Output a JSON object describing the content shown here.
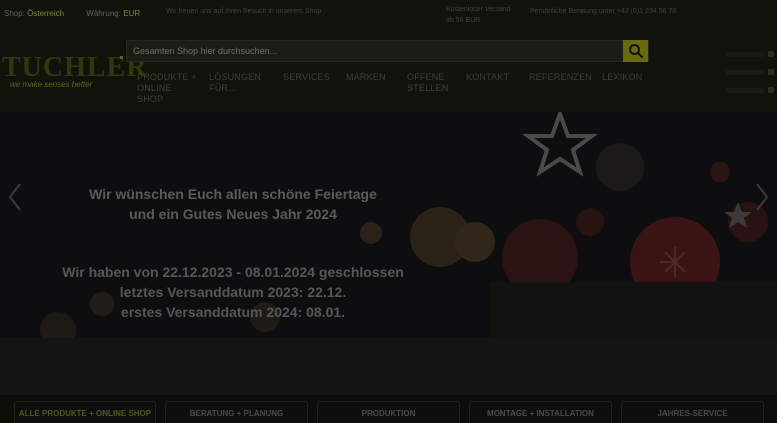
{
  "topbar": {
    "shop_label": "Shop",
    "shop_value": "Österreich",
    "currency_label": "Währung",
    "currency_value": "EUR",
    "msg_left": "Wir freuen uns auf Ihren Besuch in unserem Shop",
    "msg_center_1": "Kostenloser Versand",
    "msg_center_2": "ab 50 EUR",
    "msg_right": "Persönliche Beratung unter +43 (0)1 234 56 78"
  },
  "logo": {
    "word": "TUCHLER",
    "slogan": "we make senses better"
  },
  "search": {
    "placeholder": "Gesamten Shop hier durchsuchen...",
    "icon": "search-icon"
  },
  "nav": {
    "items": [
      {
        "label": "PRODUKTE + ONLINE SHOP"
      },
      {
        "label": "LÖSUNGEN FÜR..."
      },
      {
        "label": "SERVICES"
      },
      {
        "label": "MARKEN"
      },
      {
        "label": "OFFENE STELLEN"
      },
      {
        "label": "KONTAKT"
      },
      {
        "label": "REFERENZEN"
      },
      {
        "label": "LEXIKON"
      }
    ]
  },
  "account": {
    "login": "Anmelden",
    "wishlist": "Merkliste",
    "cart": "Warenkorb",
    "icons": [
      "user-icon",
      "heart-icon",
      "cart-icon"
    ]
  },
  "hero": {
    "greeting_line1": "Wir wünschen Euch allen schöne Feiertage",
    "greeting_line2": "und ein Gutes Neues Jahr 2024",
    "closed_line1": "Wir haben von 22.12.2023 - 08.01.2024 geschlossen",
    "closed_line2": "letztes Versanddatum 2023: 22.12.",
    "closed_line3": "erstes Versanddatum 2024: 08.01."
  },
  "categories": [
    {
      "label": "ALLE PRODUKTE + ONLINE SHOP"
    },
    {
      "label": "BERATUNG + PLANUNG"
    },
    {
      "label": "PRODUKTION"
    },
    {
      "label": "MONTAGE + INSTALLATION"
    },
    {
      "label": "JAHRES-SERVICE"
    }
  ],
  "colors": {
    "accent": "#6b6a08",
    "brand_green": "#5b6b12",
    "overlay": "#0f130b"
  }
}
